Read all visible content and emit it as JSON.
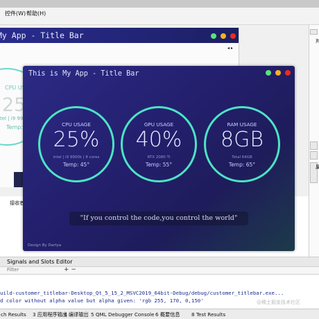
{
  "ide": {
    "menu": [
      "控件(W)",
      "帮助(H)"
    ],
    "right_panel_label": "对",
    "right_panel_side_text": "属",
    "bottom_tabs": [
      "接收者"
    ],
    "signals_slots_editor": "Signals and Slots Editor",
    "filter_placeholder": "Filter",
    "filter_buttons": "+ −",
    "output_lines": [
      "uild-customer_titlebar-Desktop_Qt_5_15_2_MSVC2019_64bit-Debug/debug/customer_titlebar.exe...",
      "d color without alpha value but alpha given: 'rgb 255, 170, 0,150'"
    ],
    "watermark": "@稀土掘金技术社区",
    "status_items": [
      "ch Results",
      "3 应用程序输出",
      "4 编译输出",
      "5 QML Debugger Console",
      "6 概要信息",
      "8 Test Results"
    ]
  },
  "background_window": {
    "title": "My App - Title Bar",
    "gauge_label": "CPU USA",
    "gauge_value": "25",
    "gauge_info": "tel | i9 9900",
    "gauge_temp": "Temp:"
  },
  "window": {
    "title": "This is My App - Title Bar",
    "controls": {
      "min_color": "#59e37a",
      "max_color": "#f6b126",
      "close_color": "#ee2b1b"
    },
    "gauges": [
      {
        "label": "CPU USAGE",
        "value": "25%",
        "info": "intel | i9 9900k | 8 cores",
        "temp": "Temp: 45°"
      },
      {
        "label": "GPU USAGE",
        "value": "40%",
        "info": "RTX 2080 TI",
        "temp": "Temp: 55°"
      },
      {
        "label": "RAM USAGE",
        "value": "8GB",
        "info": "Total 64GB",
        "temp": "Temp: 65°"
      }
    ],
    "quote": "\"If you control the code,you control the world\"",
    "footer": "Design By Dartya"
  }
}
